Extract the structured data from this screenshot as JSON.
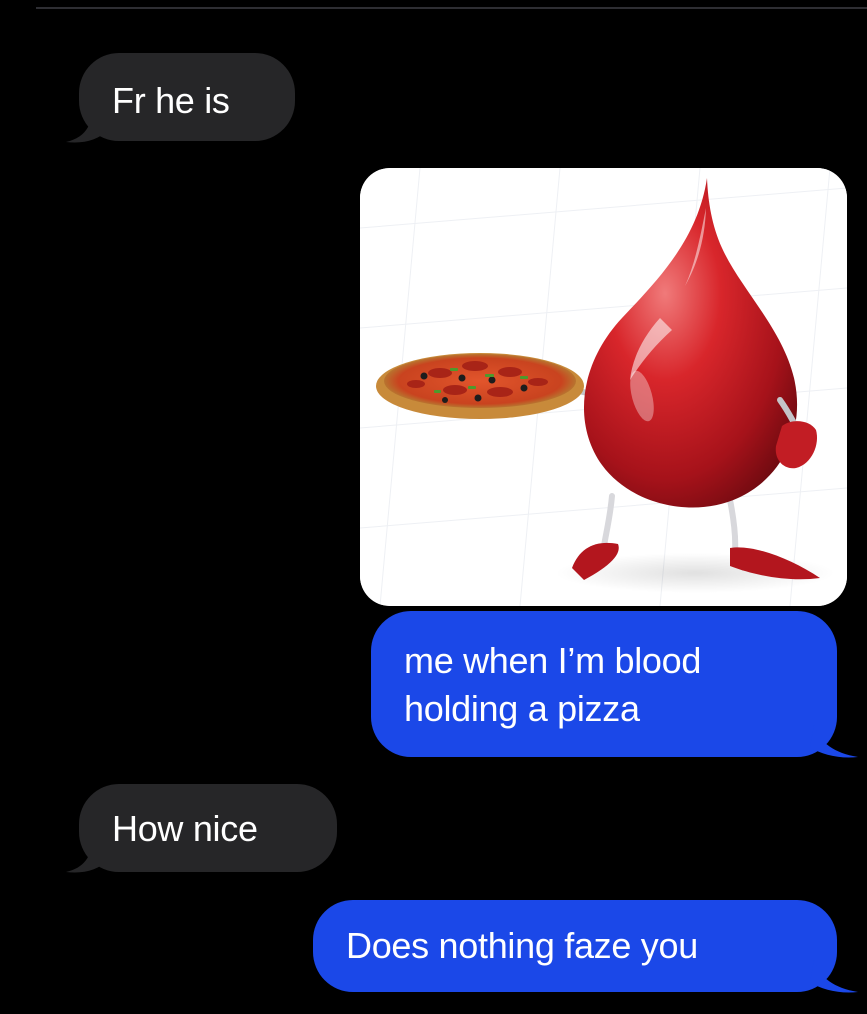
{
  "thread": {
    "messages": [
      {
        "direction": "received",
        "text": "Fr he is"
      },
      {
        "direction": "sent",
        "type": "image",
        "image_description": "blood drop character holding a pizza"
      },
      {
        "direction": "sent",
        "text": "me when I’m blood holding a pizza",
        "lines": [
          "me when I’m blood",
          "holding a pizza"
        ]
      },
      {
        "direction": "received",
        "text": "How nice"
      },
      {
        "direction": "sent",
        "text": "Does nothing faze you"
      }
    ]
  },
  "colors": {
    "background": "#000000",
    "received_bubble": "#262628",
    "sent_bubble": "#1b48e8",
    "text": "#ffffff",
    "divider": "#2e2e33"
  },
  "icons": [
    "blood-drop-character",
    "pizza"
  ]
}
